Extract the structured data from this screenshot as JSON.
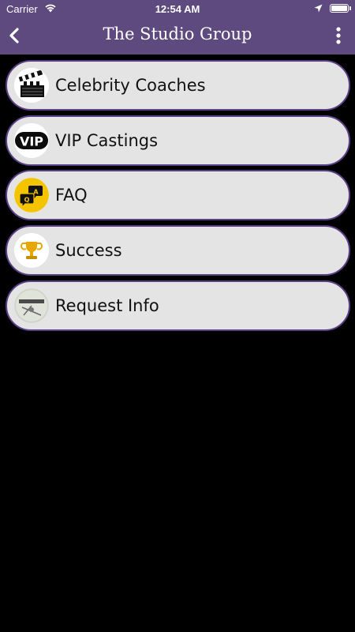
{
  "status_bar": {
    "carrier": "Carrier",
    "time": "12:54 AM",
    "battery_level": 1.0
  },
  "header": {
    "title": "The Studio Group",
    "back_icon": "chevron-left-icon",
    "more_icon": "more-vertical-icon"
  },
  "menu": {
    "items": [
      {
        "label": "Celebrity Coaches",
        "icon": "clapperboard-icon"
      },
      {
        "label": "VIP Castings",
        "icon": "vip-icon"
      },
      {
        "label": "FAQ",
        "icon": "faq-icon"
      },
      {
        "label": "Success",
        "icon": "trophy-icon"
      },
      {
        "label": "Request Info",
        "icon": "request-info-icon"
      }
    ]
  },
  "colors": {
    "header_bg": "#5e4a7f",
    "item_bg": "#e4e4e4",
    "item_border": "#5b3f86",
    "page_bg": "#000000",
    "faq_icon_bg": "#f5c400"
  }
}
